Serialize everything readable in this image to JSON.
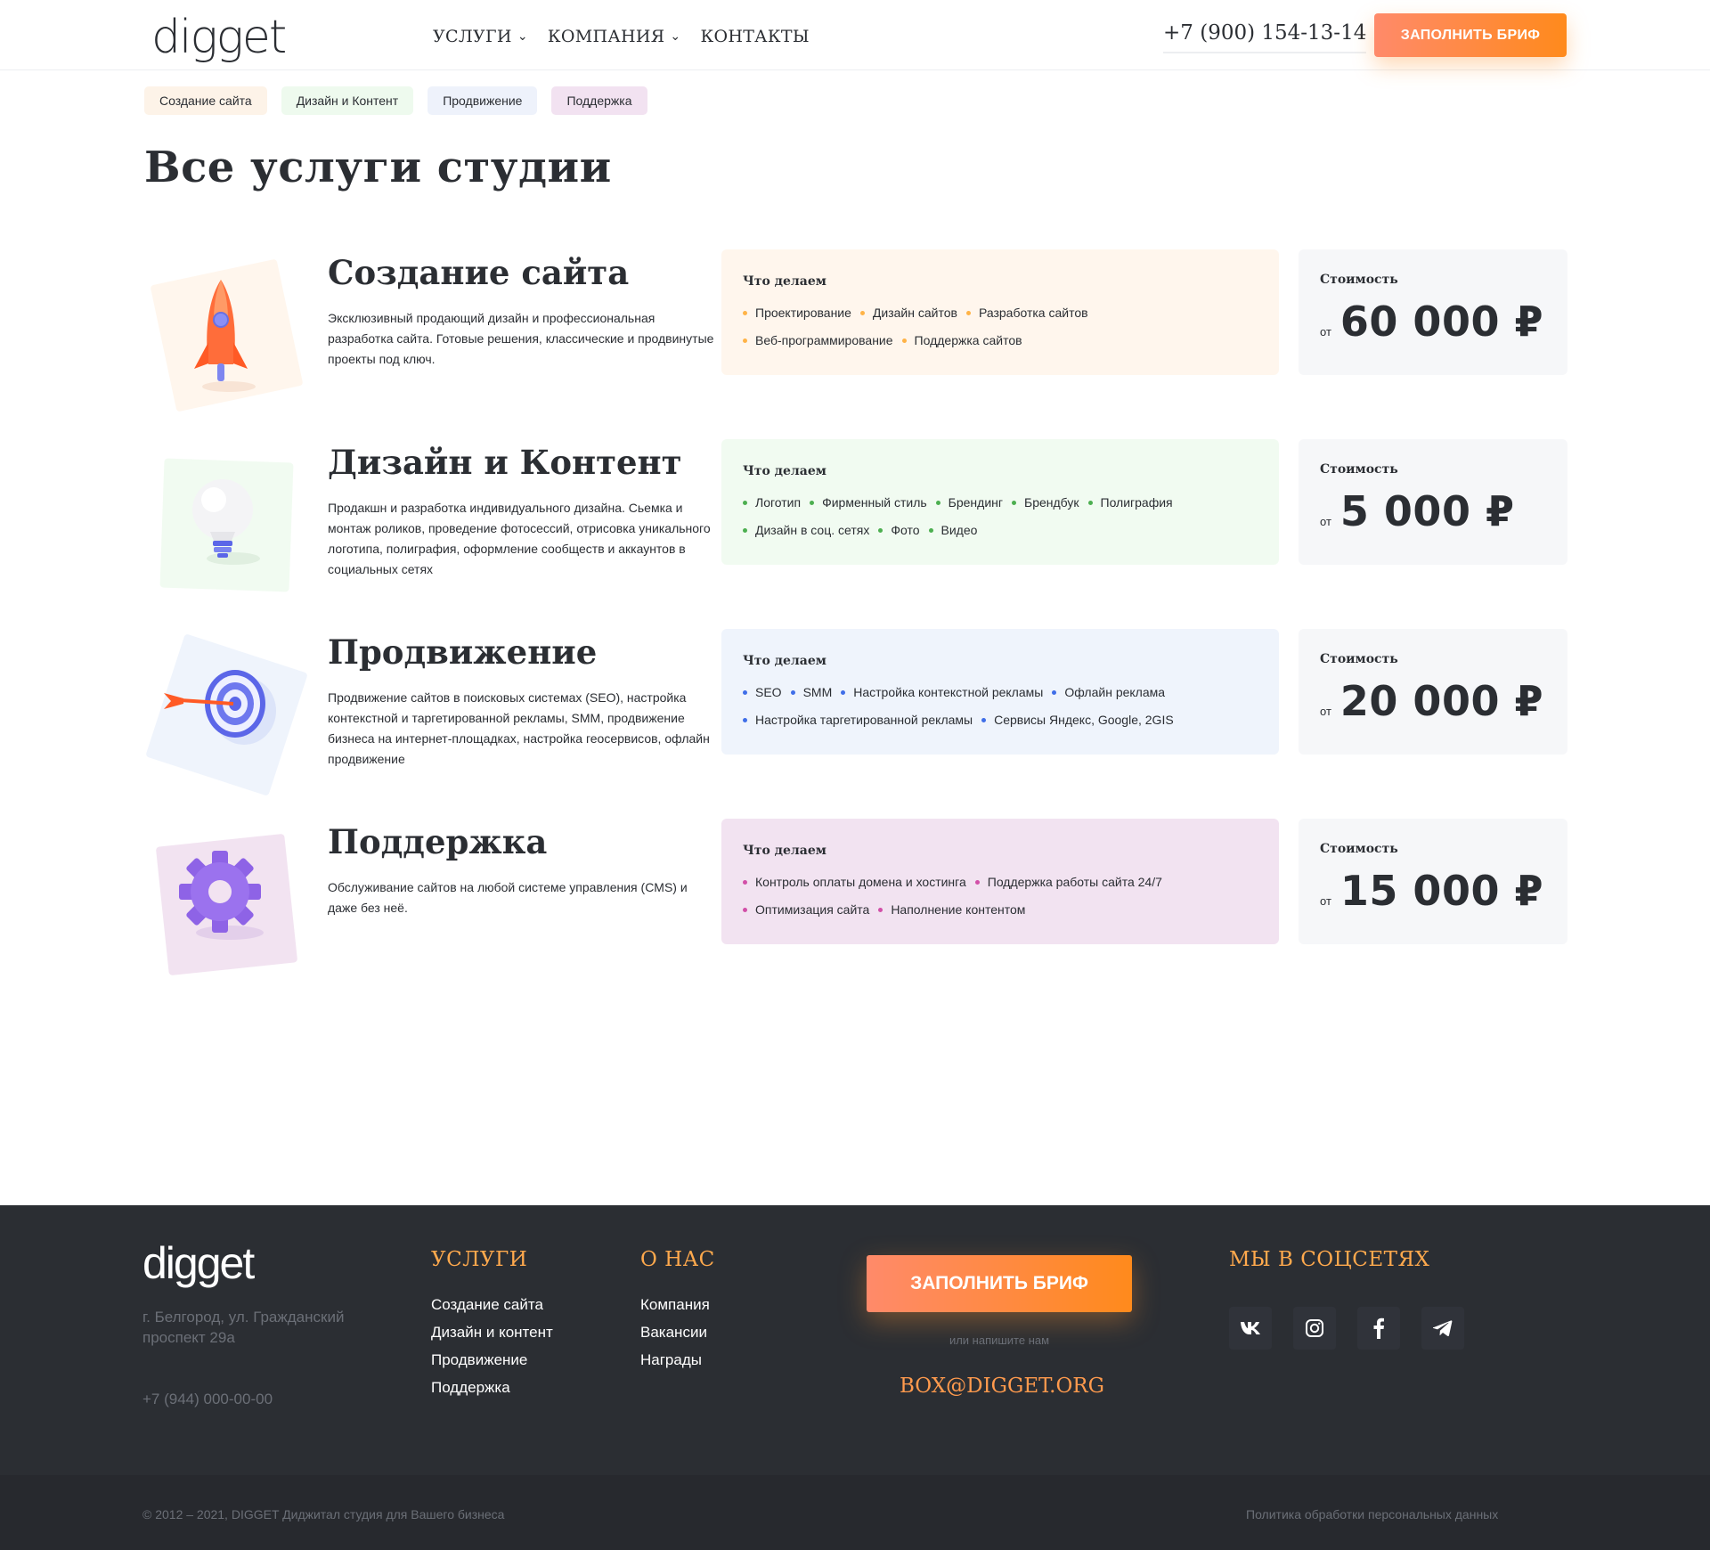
{
  "header": {
    "logo": "digget",
    "nav": [
      {
        "label": "УСЛУГИ",
        "has_dropdown": true
      },
      {
        "label": "КОМПАНИЯ",
        "has_dropdown": true
      },
      {
        "label": "КОНТАКТЫ",
        "has_dropdown": false
      }
    ],
    "phone": "+7 (900) 154-13-14",
    "cta": "ЗАПОЛНИТЬ БРИФ"
  },
  "chips": [
    {
      "label": "Создание сайта",
      "color": "#fdf3e8"
    },
    {
      "label": "Дизайн и Контент",
      "color": "#eefaee"
    },
    {
      "label": "Продвижение",
      "color": "#eef2fb"
    },
    {
      "label": "Поддержка",
      "color": "#f2e2f1"
    }
  ],
  "page_title": "Все услуги студии",
  "what_heading": "Что делаем",
  "price_heading": "Стоимость",
  "price_from": "от",
  "services": [
    {
      "title": "Создание сайта",
      "description": "Эксклюзивный продающий дизайн и профессиональная разработка сайта. Готовые решения, классические и продвинутые проекты под ключ.",
      "tags": [
        "Проектирование",
        "Дизайн сайтов",
        "Разработка сайтов",
        "Веб-программирование",
        "Поддержка сайтов"
      ],
      "price": "60 000 ₽",
      "icon": "rocket-icon",
      "bg": "#fff6ed",
      "dot": "#ffb347"
    },
    {
      "title": "Дизайн и Контент",
      "description": "Продакшн и разработка индивидуального дизайна. Сьемка и монтаж роликов, проведение фотосессий, отрисовка уникального логотипа, полиграфия, оформление сообществ и аккаунтов в социальных сетях",
      "tags": [
        "Логотип",
        "Фирменный стиль",
        "Брендинг",
        "Брендбук",
        "Полиграфия",
        "Дизайн в соц. сетях",
        "Фото",
        "Видео"
      ],
      "price": "5 000 ₽",
      "icon": "lightbulb-icon",
      "bg": "#f1fbf1",
      "dot": "#4caf50"
    },
    {
      "title": "Продвижение",
      "description": "Продвижение сайтов в поисковых системах (SEO), настройка контекстной и таргетированной рекламы, SMM, продвижение бизнеса на интернет-площадках, настройка геосервисов, офлайн продвижение",
      "tags": [
        "SEO",
        "SMM",
        "Настройка контекстной рекламы",
        "Офлайн реклама",
        "Настройка таргетированной рекламы",
        "Сервисы Яндекс, Google, 2GIS"
      ],
      "price": "20 000 ₽",
      "icon": "target-icon",
      "bg": "#eff4fc",
      "dot": "#3f6ee8"
    },
    {
      "title": "Поддержка",
      "description": "Обслуживание сайтов на любой системе управления (CMS) и даже без неё.",
      "tags": [
        "Контроль оплаты домена и хостинга",
        "Поддержка работы сайта 24/7",
        "Оптимизация сайта",
        "Наполнение контентом"
      ],
      "price": "15 000 ₽",
      "icon": "gear-icon",
      "bg": "#f2e3f1",
      "dot": "#d24fa8"
    }
  ],
  "footer": {
    "logo": "digget",
    "address": "г. Белгород, ул. Гражданский проспект 29а",
    "phone": "+7 (944) 000-00-00",
    "services_heading": "УСЛУГИ",
    "services_links": [
      "Создание сайта",
      "Дизайн и контент",
      "Продвижение",
      "Поддержка"
    ],
    "about_heading": "О НАС",
    "about_links": [
      "Компания",
      "Вакансии",
      "Награды"
    ],
    "cta": "ЗАПОЛНИТЬ БРИФ",
    "or_write": "или напишите нам",
    "email": "BOX@DIGGET.ORG",
    "social_heading": "МЫ В СОЦСЕТЯХ",
    "socials": [
      "vk-icon",
      "instagram-icon",
      "facebook-icon",
      "telegram-icon"
    ],
    "copyright": "© 2012 – 2021, DIGGET Диджитал студия для Вашего бизнеса",
    "policy": "Политика обработки персональных данных"
  }
}
